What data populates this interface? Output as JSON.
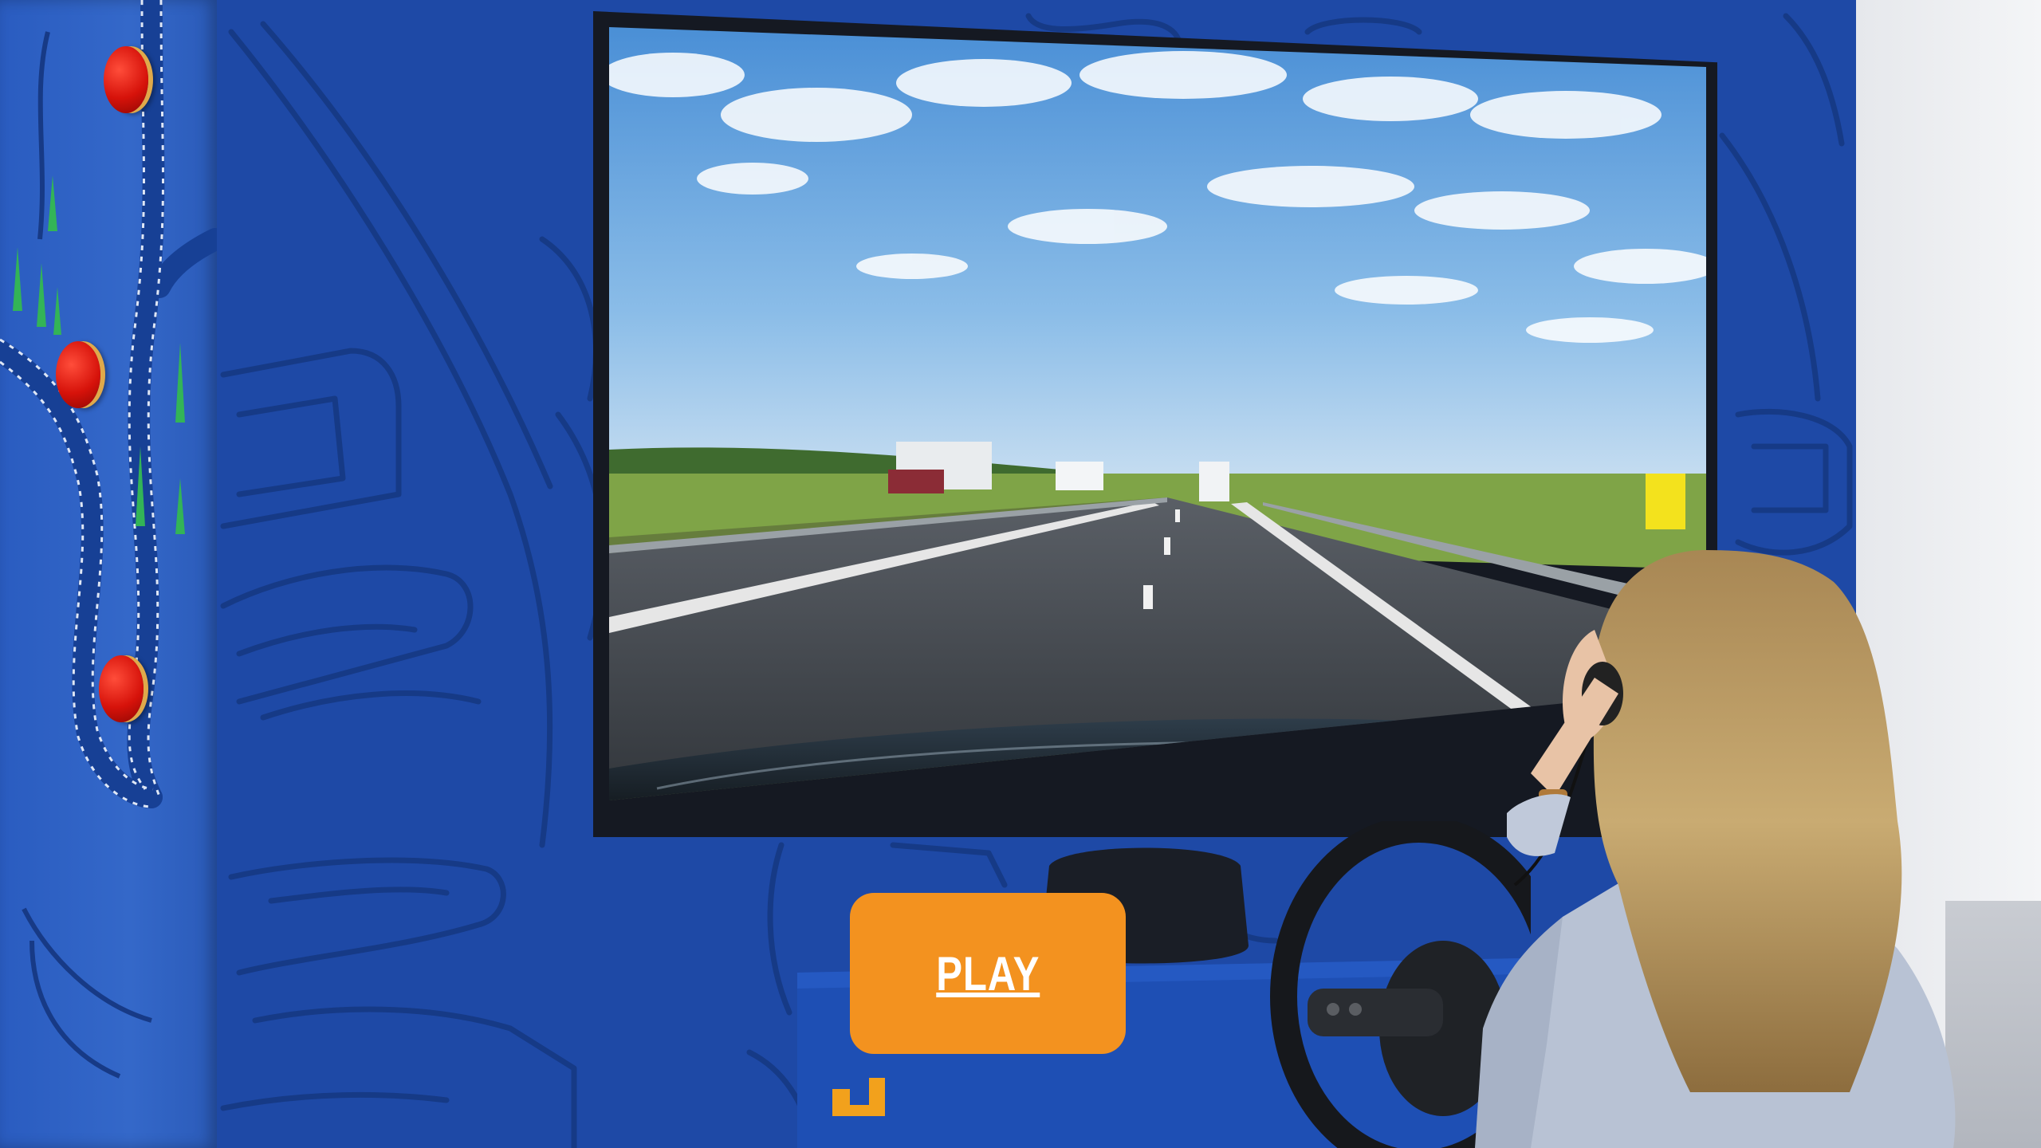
{
  "controls": {
    "play_label": "PLAY"
  },
  "colors": {
    "wall": "#1e49a6",
    "line_art": "#173a86",
    "play_button": "#f3921f",
    "play_text": "#ffffff",
    "knob": "#d6120a"
  },
  "icons": {
    "knob": "red-dome-knob",
    "hook": "cable-hook-icon",
    "wheel": "steering-wheel-icon"
  }
}
